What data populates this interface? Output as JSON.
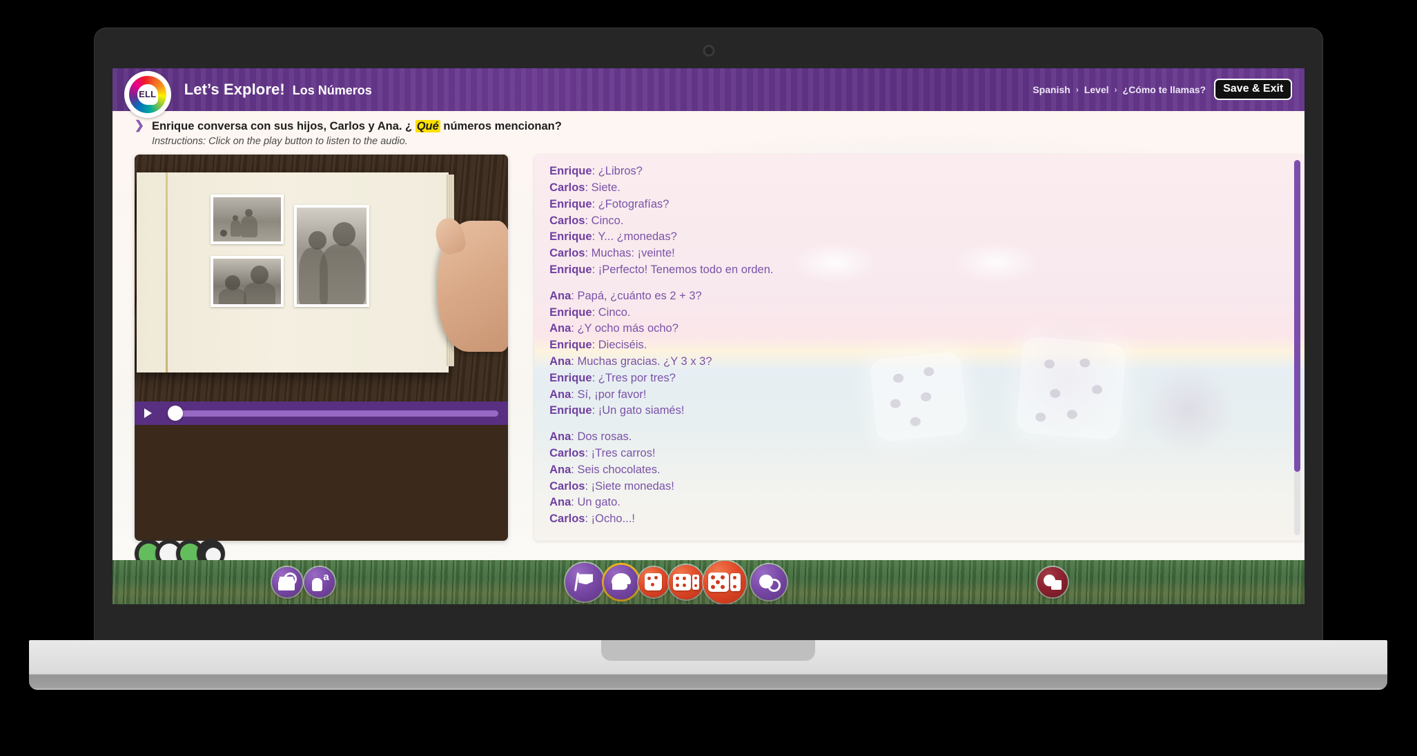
{
  "header": {
    "logo_text": "ELL",
    "app_title": "Let’s Explore!",
    "lesson_title": "Los Números",
    "breadcrumb": [
      "Spanish",
      "Level",
      "¿Cómo te llamas?"
    ],
    "separator": "›",
    "save_exit_label": "Save & Exit",
    "accent_purple": "#5e3283"
  },
  "prompt": {
    "arrow": "❯",
    "question_pre": "Enrique conversa con sus hijos, Carlos y Ana. ¿ ",
    "question_highlight": "Qué",
    "question_post": " números mencionan?",
    "instructions": "Instructions: Click on the play button to listen to the audio."
  },
  "media": {
    "audio_progress_percent": 0,
    "play_label": "▶"
  },
  "transcript": {
    "blocks": [
      [
        {
          "speaker": "Enrique",
          "text": "¿Libros?"
        },
        {
          "speaker": "Carlos",
          "text": "Siete."
        },
        {
          "speaker": "Enrique",
          "text": "¿Fotografías?"
        },
        {
          "speaker": "Carlos",
          "text": "Cinco."
        },
        {
          "speaker": "Enrique",
          "text": "Y... ¿monedas?"
        },
        {
          "speaker": "Carlos",
          "text": "Muchas: ¡veinte!"
        },
        {
          "speaker": "Enrique",
          "text": "¡Perfecto! Tenemos todo en orden."
        }
      ],
      [
        {
          "speaker": "Ana",
          "text": "Papá, ¿cuánto es 2 + 3?"
        },
        {
          "speaker": "Enrique",
          "text": "Cinco."
        },
        {
          "speaker": "Ana",
          "text": "¿Y ocho más ocho?"
        },
        {
          "speaker": "Enrique",
          "text": "Dieciséis."
        },
        {
          "speaker": "Ana",
          "text": "Muchas gracias. ¿Y 3 x 3?"
        },
        {
          "speaker": "Enrique",
          "text": "¿Tres por tres?"
        },
        {
          "speaker": "Ana",
          "text": "Sí, ¡por favor!"
        },
        {
          "speaker": "Enrique",
          "text": "¡Un gato siamés!"
        }
      ],
      [
        {
          "speaker": "Ana",
          "text": "Dos rosas."
        },
        {
          "speaker": "Carlos",
          "text": "¡Tres carros!"
        },
        {
          "speaker": "Ana",
          "text": "Seis chocolates."
        },
        {
          "speaker": "Carlos",
          "text": "¡Siete monedas!"
        },
        {
          "speaker": "Ana",
          "text": "Un gato."
        },
        {
          "speaker": "Carlos",
          "text": "¡Ocho...!"
        }
      ]
    ],
    "scroll_thumb_percent": 83
  },
  "footer_nav": {
    "left_buttons": [
      {
        "name": "glossary",
        "icon": "books-search-icon"
      },
      {
        "name": "vocabulary",
        "icon": "hand-letter-a-icon"
      }
    ],
    "center_buttons": [
      {
        "name": "start",
        "icon": "flag-icon",
        "style": "purple",
        "active": false
      },
      {
        "name": "explorer",
        "icon": "helmet-icon",
        "style": "purple",
        "active": true
      },
      {
        "name": "activity-1",
        "icon": "dice-1-icon",
        "style": "red",
        "active": false
      },
      {
        "name": "activity-2",
        "icon": "dice-2-icon",
        "style": "red",
        "active": false
      },
      {
        "name": "activity-3",
        "icon": "dice-3-icon",
        "style": "red",
        "active": false
      },
      {
        "name": "review",
        "icon": "magnifier-icon",
        "style": "purple",
        "active": false
      }
    ],
    "right_buttons": [
      {
        "name": "flashcards",
        "icon": "speech-card-icon",
        "style": "dark-red"
      }
    ]
  }
}
